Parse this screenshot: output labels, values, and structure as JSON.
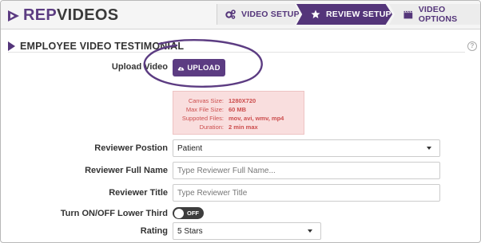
{
  "brand": {
    "part1": "REP",
    "part2": "VIDEOS"
  },
  "steps": [
    {
      "label": "VIDEO SETUP",
      "icon": "gears-icon"
    },
    {
      "label": "REVIEW SETUP",
      "icon": "star-icon"
    },
    {
      "label": "VIDEO OPTIONS",
      "icon": "film-icon"
    }
  ],
  "section": {
    "title": "EMPLOYEE VIDEO TESTIMONIAL",
    "help": "?"
  },
  "upload": {
    "label": "Upload Video",
    "button": "UPLOAD"
  },
  "info": {
    "rows": [
      {
        "key": "Canvas Size:",
        "value": "1280X720"
      },
      {
        "key": "Max File Size:",
        "value": "60 MB"
      },
      {
        "key": "Suppoted Files:",
        "value": "mov, avi, wmv, mp4"
      },
      {
        "key": "Duration:",
        "value": "2 min max"
      }
    ]
  },
  "form": {
    "position": {
      "label": "Reviewer Postion",
      "value": "Patient"
    },
    "full_name": {
      "label": "Reviewer Full Name",
      "placeholder": "Type Reviewer Full Name..."
    },
    "title": {
      "label": "Reviewer Title",
      "placeholder": "Type Reviewer Title"
    },
    "lower_third": {
      "label": "Turn ON/OFF Lower Third",
      "state": "OFF"
    },
    "rating": {
      "label": "Rating",
      "value": "5 Stars"
    }
  },
  "colors": {
    "brand_purple": "#5c3c82",
    "info_bg": "#f9dede",
    "info_text": "#cc4d4d"
  }
}
